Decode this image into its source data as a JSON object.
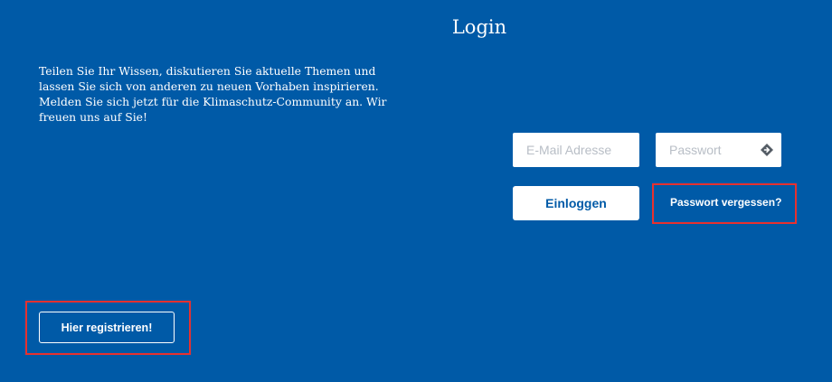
{
  "header": {
    "title": "Login"
  },
  "intro": {
    "text": "Teilen Sie Ihr Wissen, diskutieren Sie aktuelle Themen und lassen Sie sich von anderen zu neuen Vorhaben inspirieren. Melden Sie sich jetzt für die Klimaschutz-Community an. Wir freuen uns auf Sie!"
  },
  "form": {
    "email": {
      "placeholder": "E-Mail Adresse",
      "value": ""
    },
    "password": {
      "placeholder": "Passwort",
      "value": "",
      "icon": "key-icon"
    },
    "login_label": "Einloggen",
    "forgot_label": "Passwort vergessen?"
  },
  "register": {
    "label": "Hier registrieren!"
  },
  "colors": {
    "background": "#005aa7",
    "highlight_border": "#e8312f",
    "button_text": "#005aa7"
  }
}
